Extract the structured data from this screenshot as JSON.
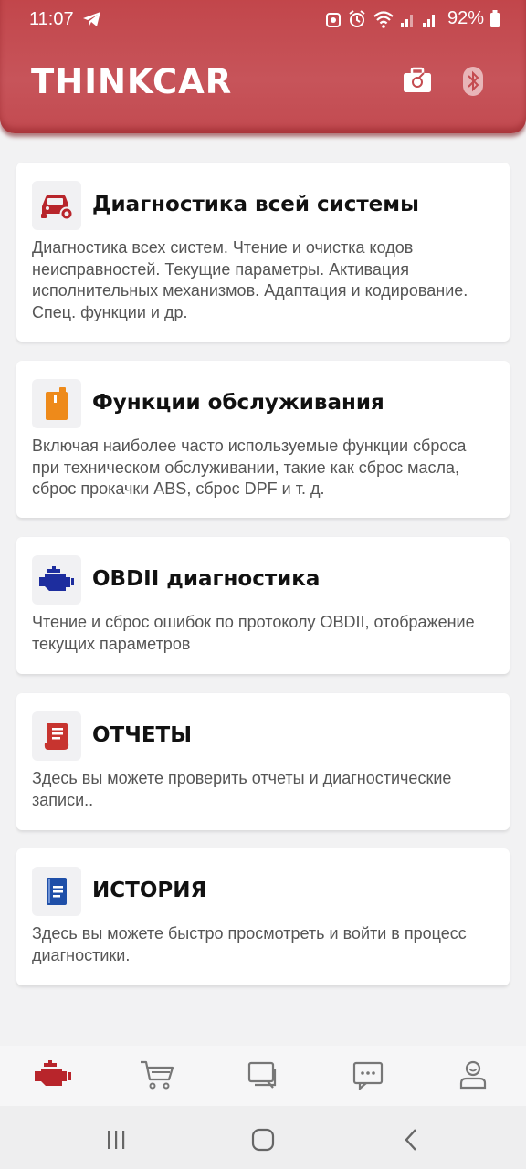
{
  "status_bar": {
    "time": "11:07",
    "battery": "92%"
  },
  "header": {
    "brand": "THINKCAR",
    "icons": [
      "toolbox-icon",
      "bluetooth-icon"
    ],
    "color": "#c44b50"
  },
  "cards": [
    {
      "icon": "car-diagnostic-icon",
      "title": "Диагностика всей системы",
      "description": "Диагностика всех систем. Чтение и очистка кодов неисправностей. Текущие параметры. Активация исполнительных механизмов. Адаптация и кодирование. Спец. функции и др."
    },
    {
      "icon": "oil-can-icon",
      "title": "Функции обслуживания",
      "description": "Включая наиболее часто используемые функции сброса при техническом обслуживании, такие как сброс масла, сброс прокачки ABS, сброс DPF и т. д."
    },
    {
      "icon": "engine-icon",
      "title": "OBDII диагностика",
      "description": "Чтение и сброс ошибок по протоколу OBDII, отображение текущих параметров"
    },
    {
      "icon": "report-scroll-icon",
      "title": "ОТЧЕТЫ",
      "description": "Здесь вы можете проверить отчеты и диагностические записи.."
    },
    {
      "icon": "history-book-icon",
      "title": "ИСТОРИЯ",
      "description": "Здесь вы можете быстро просмотреть и войти в процесс диагностики."
    }
  ],
  "bottom_nav": {
    "items": [
      "engine-tab-icon",
      "cart-icon",
      "chat-icon",
      "messages-icon",
      "profile-icon"
    ],
    "active_color": "#b8252b",
    "inactive_color": "#777777"
  },
  "system_nav": [
    "recent-apps-icon",
    "home-icon",
    "back-icon"
  ]
}
